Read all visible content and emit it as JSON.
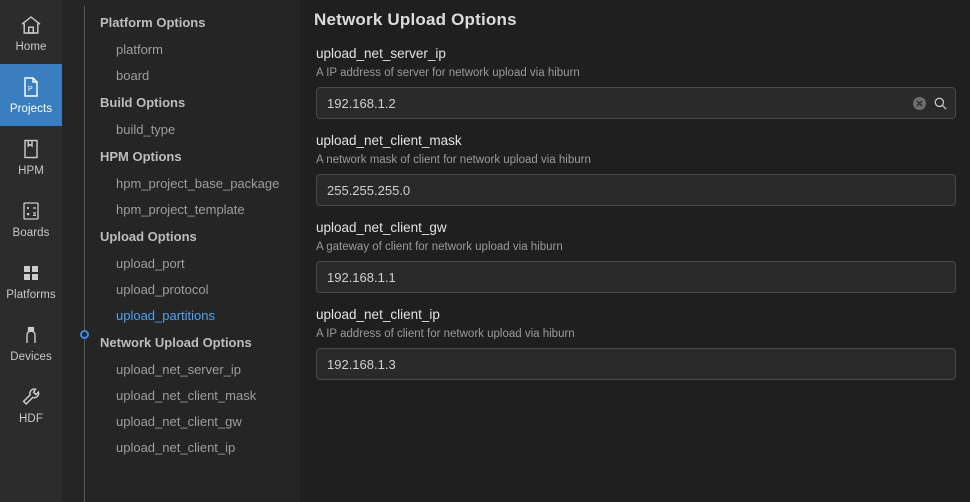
{
  "activity_bar": {
    "items": [
      {
        "label": "Home",
        "icon": "home-icon",
        "active": false
      },
      {
        "label": "Projects",
        "icon": "project-file-icon",
        "active": true
      },
      {
        "label": "HPM",
        "icon": "book-icon",
        "active": false
      },
      {
        "label": "Boards",
        "icon": "calculator-icon",
        "active": false
      },
      {
        "label": "Platforms",
        "icon": "grid-icon",
        "active": false
      },
      {
        "label": "Devices",
        "icon": "usb-device-icon",
        "active": false
      },
      {
        "label": "HDF",
        "icon": "wrench-icon",
        "active": false
      }
    ]
  },
  "settings_tree": {
    "groups": [
      {
        "title": "Platform Options",
        "items": [
          {
            "label": "platform",
            "selected": false
          },
          {
            "label": "board",
            "selected": false
          }
        ]
      },
      {
        "title": "Build Options",
        "items": [
          {
            "label": "build_type",
            "selected": false
          }
        ]
      },
      {
        "title": "HPM Options",
        "items": [
          {
            "label": "hpm_project_base_package",
            "selected": false
          },
          {
            "label": "hpm_project_template",
            "selected": false
          }
        ]
      },
      {
        "title": "Upload Options",
        "items": [
          {
            "label": "upload_port",
            "selected": false
          },
          {
            "label": "upload_protocol",
            "selected": false
          },
          {
            "label": "upload_partitions",
            "selected": true
          }
        ]
      },
      {
        "title": "Network Upload Options",
        "items": [
          {
            "label": "upload_net_server_ip",
            "selected": false
          },
          {
            "label": "upload_net_client_mask",
            "selected": false
          },
          {
            "label": "upload_net_client_gw",
            "selected": false
          },
          {
            "label": "upload_net_client_ip",
            "selected": false
          }
        ]
      }
    ]
  },
  "content": {
    "title": "Network Upload Options",
    "fields": [
      {
        "label": "upload_net_server_ip",
        "description": "A IP address of server for network upload via hiburn",
        "value": "192.168.1.2",
        "has_actions": true
      },
      {
        "label": "upload_net_client_mask",
        "description": "A network mask of client for network upload via hiburn",
        "value": "255.255.255.0",
        "has_actions": false
      },
      {
        "label": "upload_net_client_gw",
        "description": "A gateway of client for network upload via hiburn",
        "value": "192.168.1.1",
        "has_actions": false
      },
      {
        "label": "upload_net_client_ip",
        "description": "A IP address of client for network upload via hiburn",
        "value": "192.168.1.3",
        "has_actions": false
      }
    ]
  },
  "colors": {
    "accent": "#3a7ebf",
    "selected_link": "#4ea1f5",
    "activity_bg": "#2c2c2c",
    "tree_bg": "#252526",
    "content_bg": "#1f1f1f"
  }
}
